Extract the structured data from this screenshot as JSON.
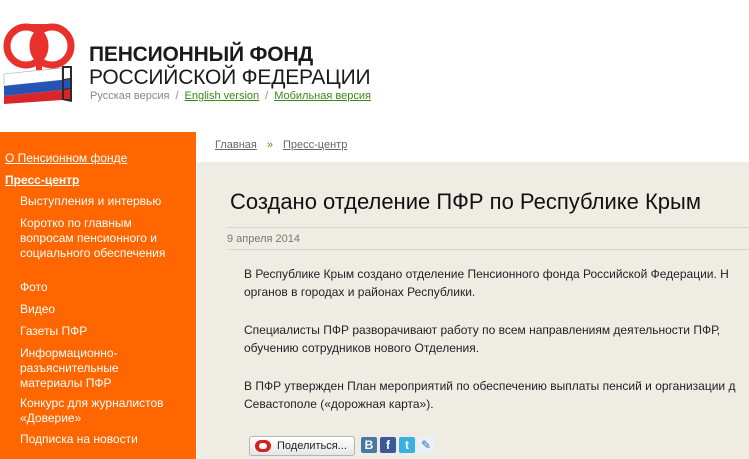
{
  "header": {
    "title_line1": "ПЕНСИОННЫЙ ФОНД",
    "title_line2": "РОССИЙСКОЙ ФЕДЕРАЦИИ",
    "lang_current": "Русская версия",
    "lang_english": "English version",
    "lang_mobile": "Мобильная версия",
    "separator": "/"
  },
  "sidebar": {
    "top_items": [
      {
        "label": "О Пенсионном фонде"
      },
      {
        "label": "Пресс-центр"
      }
    ],
    "sub_items": [
      {
        "label": "Выступления и интервью"
      },
      {
        "label": "Коротко по главным вопросам пенсионного и социального обеспечения"
      },
      {
        "label": "Фото"
      },
      {
        "label": "Видео"
      },
      {
        "label": "Газеты ПФР"
      },
      {
        "label": "Информационно-разъяснительные материалы ПФР"
      },
      {
        "label": "Конкурс для журналистов «Доверие»"
      },
      {
        "label": "Подписка на новости"
      }
    ]
  },
  "breadcrumb": {
    "home": "Главная",
    "arrow": "»",
    "section": "Пресс-центр"
  },
  "article": {
    "title": "Создано отделение ПФР по Республике Крым",
    "date": "9 апреля 2014",
    "p1_line1": "В Республике Крым создано отделение Пенсионного фонда Российской Федерации. Н",
    "p1_line2": "органов в городах и районах Республики.",
    "p2_line1": "Специалисты ПФР разворачивают работу по всем направлениям деятельности ПФР,",
    "p2_line2": "обучению сотрудников нового Отделения.",
    "p3_line1": "В ПФР утвержден План мероприятий по обеспечению выплаты пенсий и организации д",
    "p3_line2": "Севастополе («дорожная карта»)."
  },
  "share": {
    "label": "Поделиться...",
    "vk": "В",
    "fb": "f",
    "tw": "t",
    "lj": "✎"
  },
  "colors": {
    "sidebar": "#ff6600",
    "logo_red": "#e8312a",
    "link_green": "#3a8a1a",
    "content_bg": "#efece4"
  }
}
